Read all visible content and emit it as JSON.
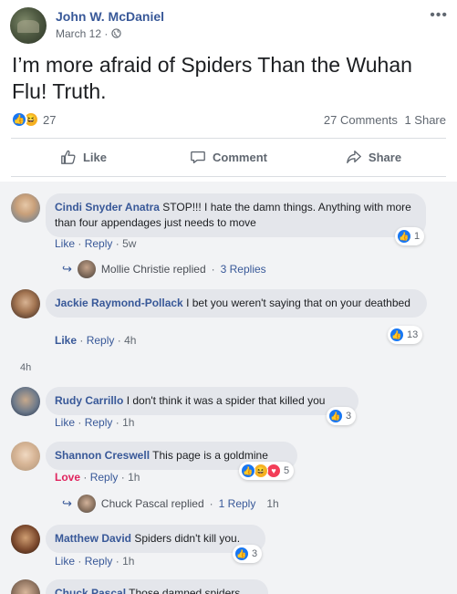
{
  "post": {
    "author": "John W. McDaniel",
    "date": "March 12",
    "privacy_separator": "·",
    "text": "I’m more afraid of Spiders Than the Wuhan Flu! Truth.",
    "reactions_count": "27",
    "comments_count": "27 Comments",
    "shares_count": "1 Share"
  },
  "actions": {
    "like": "Like",
    "comment": "Comment",
    "share": "Share"
  },
  "comments": [
    {
      "name": "Cindi Snyder Anatra",
      "text": "STOP!!! I hate the damn things. Anything with more than four appendages just needs to move",
      "like": "Like",
      "reply": "Reply",
      "time": "5w",
      "reactions": "1"
    },
    {
      "name": "Jackie Raymond-Pollack",
      "text": "I bet you weren't saying that on your deathbed",
      "like": "Like",
      "reply": "Reply",
      "time": "4h",
      "reactions": "13"
    },
    {
      "name": "Rudy Carrillo",
      "text": "I don't think it was a spider that killed you",
      "like": "Like",
      "reply": "Reply",
      "time": "1h",
      "reactions": "3"
    },
    {
      "name": "Shannon Creswell",
      "text": "This page is a goldmine",
      "like": "Love",
      "reply": "Reply",
      "time": "1h",
      "reactions": "5"
    },
    {
      "name": "Matthew David",
      "text": "Spiders didn't kill you.",
      "like": "Like",
      "reply": "Reply",
      "time": "1h",
      "reactions": "3"
    },
    {
      "name": "Chuck Pascal",
      "text": "Those damned spiders"
    }
  ],
  "replies": [
    {
      "name": "Mollie Christie replied",
      "sep": "·",
      "count": "3 Replies",
      "time": ""
    },
    {
      "name": "Chuck Pascal replied",
      "sep": "·",
      "count": "1 Reply",
      "time": "1h"
    }
  ],
  "lone_timestamp": "4h",
  "dot": "·",
  "colors": {
    "link": "#385898",
    "like_blue": "#1877f2",
    "love_red": "#e0245e",
    "bubble": "#e4e6eb",
    "comments_bg": "#f2f3f5"
  }
}
